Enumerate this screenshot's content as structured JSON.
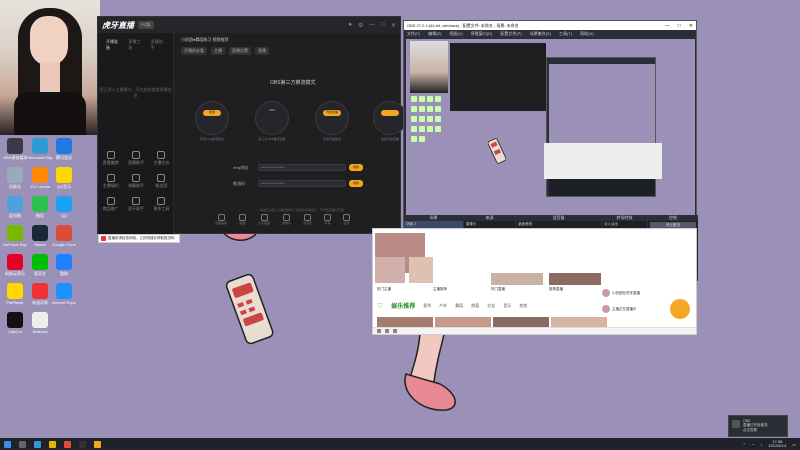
{
  "desktop": {
    "icons": [
      {
        "label": "OBS源自媒体(64bit)",
        "color": "#3a3a4a"
      },
      {
        "label": "Microsoft Edge",
        "color": "#2f9bd5"
      },
      {
        "label": "腾讯会议",
        "color": "#1f7ae0"
      },
      {
        "label": "回收站",
        "color": "#9ab"
      },
      {
        "label": "VLC media",
        "color": "#f80"
      },
      {
        "label": "QQ音乐",
        "color": "#ffd700"
      },
      {
        "label": "此电脑",
        "color": "#4aa3df"
      },
      {
        "label": "微信",
        "color": "#2ac150"
      },
      {
        "label": "QQ",
        "color": "#1aa1f4"
      },
      {
        "label": "GeForce Experience",
        "color": "#76b900"
      },
      {
        "label": "Steam",
        "color": "#1b2838"
      },
      {
        "label": "Google Chrome",
        "color": "#dd4b39"
      },
      {
        "label": "网易云音乐",
        "color": "#e60026"
      },
      {
        "label": "爱奇艺",
        "color": "#00be06"
      },
      {
        "label": "酷狗",
        "color": "#2180ff"
      },
      {
        "label": "PotPlayer",
        "color": "#ffd800"
      },
      {
        "label": "有道词典",
        "color": "#e33"
      },
      {
        "label": "Internet Explorer",
        "color": "#1e90ff"
      },
      {
        "label": "CapCut",
        "color": "#111"
      },
      {
        "label": "Notepad",
        "color": "#eee"
      }
    ]
  },
  "huya_app": {
    "logo": "虎牙直播",
    "version_badge": "PC版",
    "left_tabs": [
      "开播准备",
      "直播工具",
      "直播助手"
    ],
    "left_message": "您已进入主播模式，可在此处查看直播信息",
    "crumb_title": "小奶团●舞蹈练习 视频推荐",
    "crumb_chips": [
      "开播前必看",
      "主播",
      "直播设置",
      "直播"
    ],
    "section_title": "OBS第三方推流模式",
    "steps": [
      {
        "pill": "推流",
        "text": "获取rtmp推流地址"
      },
      {
        "pill": "OBS",
        "text": "第三方OBS推流设置"
      },
      {
        "pill": "开始直播",
        "text": "点击开始推流"
      },
      {
        "pill": "",
        "text": "在此开始直播"
      }
    ],
    "rtmp_label": "rtmp地址",
    "rtmp_value": "***************",
    "rtmp_button": "复制",
    "key_label": "推流码",
    "key_value": "***************",
    "key_button": "复制",
    "hint": "本窗口为第三方推流模式下的信息获取窗口，不代表直播已开始",
    "tools": [
      "直播美颜",
      "直播助手",
      "主播任务",
      "主播福利",
      "弹幕助手",
      "粉丝团",
      "商品推广",
      "虎牙助手",
      "更多工具"
    ],
    "bottom_tools": [
      "直播画质",
      "贴图",
      "文字贴图",
      "摄像头",
      "麦克风",
      "声音",
      "设置"
    ],
    "status_text": "直播前请检查网络，立即测速并获取推流码",
    "notification": "直播前请检查网络，立即测速并获取推流码"
  },
  "obs": {
    "title": "OBS 27.2.4 (64-bit, windows) - 配置文件: 未命名 - 场景: 未命名",
    "menus": [
      "文件(F)",
      "编辑(E)",
      "视图(V)",
      "停靠窗口(D)",
      "配置文件(P)",
      "场景集合(S)",
      "工具(T)",
      "帮助(H)"
    ],
    "docks": {
      "scenes_header": "场景",
      "scenes": [
        "场景 2",
        "场景"
      ],
      "sources_header": "来源",
      "sources": [
        "摄像头",
        "窗口采集",
        "图片",
        "显示器采集"
      ],
      "mixer_header": "混音器",
      "mixer": [
        "桌面音频",
        "麦克风/Aux"
      ],
      "transition_header": "转场特效",
      "transition_value": "淡入淡出",
      "duration_label": "时长",
      "duration_value": "300 ms",
      "controls_header": "控制",
      "controls": [
        "停止推流",
        "开始录制",
        "启动虚拟摄像机",
        "工作室模式",
        "设置",
        "退出"
      ]
    },
    "status": "LIVE: 00:04:23  REC: 00:00:00  CPU: 8.2%, 30.00 fps"
  },
  "web": {
    "section_title": "娱乐推荐",
    "section_tabs": [
      "星秀",
      "户外",
      "舞蹈",
      "颜值",
      "交友",
      "音乐",
      "其他"
    ],
    "side_items": [
      "小奶团在虎牙直播",
      "主播正在直播中"
    ],
    "captions": [
      "热门主播",
      "主播推荐",
      "热门直播",
      "推荐直播",
      "热门主播",
      "精彩推荐"
    ]
  },
  "taskbar": {
    "time": "17:58",
    "date": "2022/6/14"
  },
  "toast": {
    "line1": "OBS",
    "line2": "直播已开始推流",
    "line3": "点击查看"
  }
}
